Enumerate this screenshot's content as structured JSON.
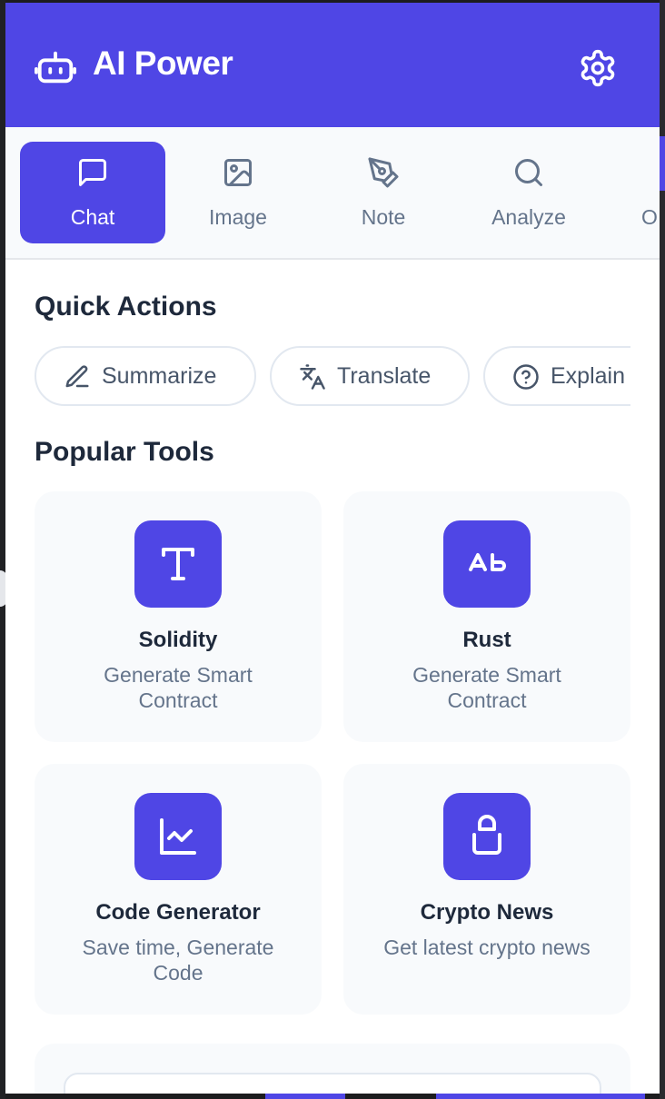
{
  "header": {
    "title": "AI Power",
    "brand_icon": "robot-icon",
    "settings_icon": "gear-icon"
  },
  "tabs": [
    {
      "label": "Chat",
      "icon": "chat-bubble-icon",
      "active": true
    },
    {
      "label": "Image",
      "icon": "image-icon",
      "active": false
    },
    {
      "label": "Note",
      "icon": "pen-nib-icon",
      "active": false
    },
    {
      "label": "Analyze",
      "icon": "search-icon",
      "active": false
    },
    {
      "label": "O",
      "icon": "partial-icon",
      "active": false
    }
  ],
  "quick_actions": {
    "title": "Quick Actions",
    "items": [
      {
        "label": "Summarize",
        "icon": "pencil-icon"
      },
      {
        "label": "Translate",
        "icon": "translate-icon"
      },
      {
        "label": "Explain",
        "icon": "help-circle-icon"
      }
    ]
  },
  "popular_tools": {
    "title": "Popular Tools",
    "items": [
      {
        "title": "Solidity",
        "desc": "Generate Smart Contract",
        "icon": "text-t-icon"
      },
      {
        "title": "Rust",
        "desc": "Generate Smart Contract",
        "icon": "text-ap-icon"
      },
      {
        "title": "Code Generator",
        "desc": "Save time, Generate Code",
        "icon": "line-chart-icon"
      },
      {
        "title": "Crypto News",
        "desc": "Get latest crypto news",
        "icon": "shopping-bag-icon"
      }
    ]
  },
  "colors": {
    "accent": "#4f46e5",
    "text_dark": "#1e293b",
    "text_muted": "#64748b",
    "card_bg": "#f8fafc"
  }
}
